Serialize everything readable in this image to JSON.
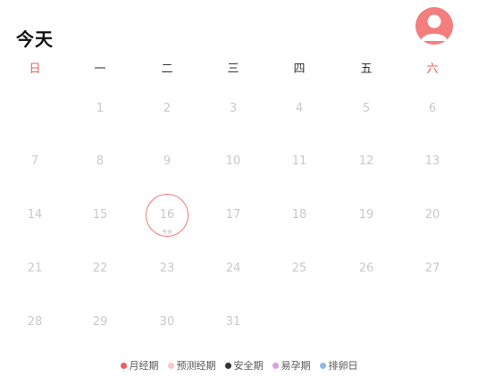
{
  "header": {
    "title": "今天",
    "avatar_icon": "user-avatar-icon",
    "avatar_color": "#f47d7d"
  },
  "calendar": {
    "weekdays": [
      "日",
      "一",
      "二",
      "三",
      "四",
      "五",
      "六"
    ],
    "weekend_color": "#e85b5b",
    "today_label": "今天",
    "today_ring_color": "#f07a7a",
    "weeks": [
      [
        "",
        "1",
        "2",
        "3",
        "4",
        "5",
        "6"
      ],
      [
        "7",
        "8",
        "9",
        "10",
        "11",
        "12",
        "13"
      ],
      [
        "14",
        "15",
        "16",
        "17",
        "18",
        "19",
        "20"
      ],
      [
        "21",
        "22",
        "23",
        "24",
        "25",
        "26",
        "27"
      ],
      [
        "28",
        "29",
        "30",
        "31",
        "",
        "",
        ""
      ]
    ],
    "today": "16"
  },
  "legend": [
    {
      "label": "月经期",
      "color": "#f05a5a"
    },
    {
      "label": "预测经期",
      "color": "#f7c6cc"
    },
    {
      "label": "安全期",
      "color": "#333333"
    },
    {
      "label": "易孕期",
      "color": "#d7a0e6"
    },
    {
      "label": "排卵日",
      "color": "#8fb7ea"
    }
  ]
}
